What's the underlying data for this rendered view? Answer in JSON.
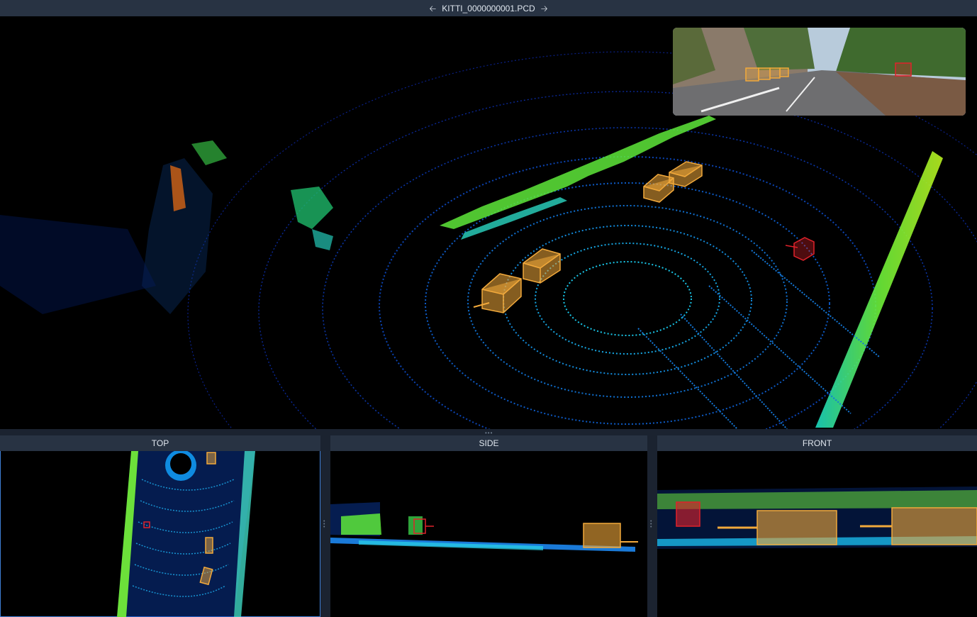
{
  "header": {
    "filename": "KITTI_0000000001.PCD",
    "prev_icon": "arrow-left-icon",
    "next_icon": "arrow-right-icon"
  },
  "views": {
    "top": "TOP",
    "side": "SIDE",
    "front": "FRONT"
  },
  "colors": {
    "cuboid_car": "#f2a93b",
    "cuboid_pedestrian": "#e0222b",
    "active_border": "#3f7fd6",
    "header_bg": "#283343"
  }
}
